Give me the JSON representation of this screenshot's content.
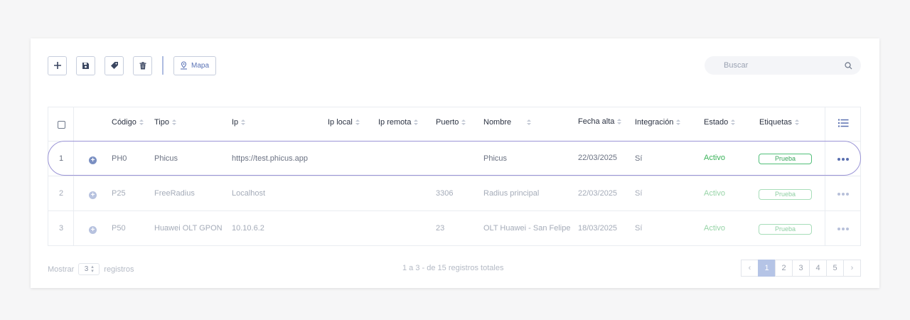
{
  "toolbar": {
    "add_icon": "plus-icon",
    "save_icon": "floppy-icon",
    "tag_icon": "tag-icon",
    "delete_icon": "trash-icon",
    "map_label": "Mapa",
    "map_icon": "map-pin-icon"
  },
  "search": {
    "placeholder": "Buscar",
    "icon": "search-icon"
  },
  "table": {
    "columns": {
      "codigo": "Código",
      "tipo": "Tipo",
      "ip": "Ip",
      "ip_local": "Ip local",
      "ip_remota": "Ip remota",
      "puerto": "Puerto",
      "nombre": "Nombre",
      "fecha_alta": "Fecha alta",
      "integracion": "Integración",
      "estado": "Estado",
      "etiquetas": "Etiquetas"
    },
    "column_menu_icon": "list-icon",
    "rows": [
      {
        "n": "1",
        "codigo": "PH0",
        "tipo": "Phicus",
        "ip": "https://test.phicus.app",
        "ip_local": "",
        "ip_remota": "",
        "puerto": "",
        "nombre": "Phicus",
        "fecha": "22/03/2025",
        "integracion": "Sí",
        "estado": "Activo",
        "etiqueta": "Prueba"
      },
      {
        "n": "2",
        "codigo": "P25",
        "tipo": "FreeRadius",
        "ip": "Localhost",
        "ip_local": "",
        "ip_remota": "",
        "puerto": "3306",
        "nombre": "Radius principal",
        "fecha": "22/03/2025",
        "integracion": "Sí",
        "estado": "Activo",
        "etiqueta": "Prueba"
      },
      {
        "n": "3",
        "codigo": "P50",
        "tipo": "Huawei OLT GPON",
        "ip": "10.10.6.2",
        "ip_local": "",
        "ip_remota": "",
        "puerto": "23",
        "nombre": "OLT Huawei - San Felipe",
        "fecha": "18/03/2025",
        "integracion": "Sí",
        "estado": "Activo",
        "etiqueta": "Prueba"
      }
    ]
  },
  "footer": {
    "show_label": "Mostrar",
    "page_size": "3",
    "records_label": "registros",
    "summary": "1 a 3 - de 15 registros totales",
    "pages": [
      "1",
      "2",
      "3",
      "4",
      "5"
    ],
    "prev": "‹",
    "next": "›"
  },
  "colors": {
    "accent": "#5a6fb0",
    "active_status": "#3bb35a",
    "highlight": "#9b95d6"
  }
}
